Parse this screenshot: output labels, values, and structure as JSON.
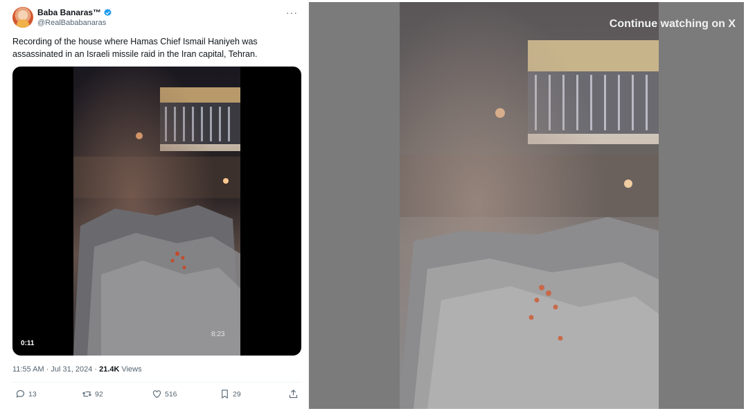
{
  "tweet": {
    "author": {
      "name": "Baba Banaras™",
      "handle": "@RealBababanaras",
      "verified": true,
      "avatar_icon": "avatar-portrait"
    },
    "more_icon": "more-dots-icon",
    "text": "Recording of the house where Hamas Chief Ismail Haniyeh was assassinated in an Israeli missile raid in the Iran capital, Tehran.",
    "media": {
      "duration": "0:11",
      "overlay_text": "8:23"
    },
    "timestamp": "11:55 AM · Jul 31, 2024 ·",
    "views_count": "21.4K",
    "views_label": "Views",
    "actions": {
      "replies": "13",
      "reposts": "92",
      "likes": "516",
      "bookmarks": "29"
    },
    "colors": {
      "verified": "#1d9bf0",
      "secondary_text": "#536471"
    }
  },
  "player": {
    "continue_label": "Continue watching on X",
    "overlay_color": "#7b7b7b"
  }
}
